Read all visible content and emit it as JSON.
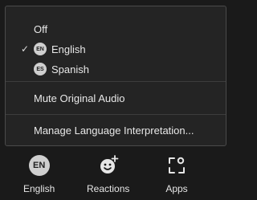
{
  "menu": {
    "items": [
      {
        "label": "Off",
        "checked": false,
        "badge": ""
      },
      {
        "label": "English",
        "checked": true,
        "badge": "EN"
      },
      {
        "label": "Spanish",
        "checked": false,
        "badge": "ES"
      }
    ],
    "check_glyph": "✓",
    "mute_label": "Mute Original Audio",
    "manage_label": "Manage Language Interpretation..."
  },
  "toolbar": {
    "english": {
      "label": "English",
      "badge": "EN"
    },
    "reactions": {
      "label": "Reactions",
      "icon": "smiley-plus-icon"
    },
    "apps": {
      "label": "Apps",
      "icon": "apps-icon"
    }
  }
}
